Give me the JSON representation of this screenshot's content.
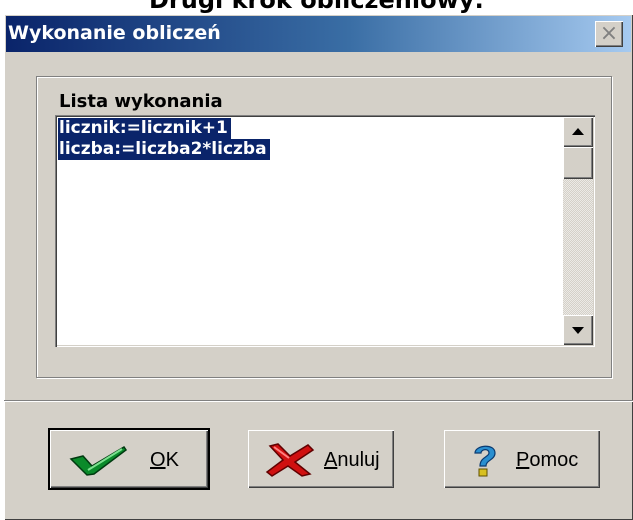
{
  "background": {
    "caption": "Drugi krok obliczeniowy:"
  },
  "window": {
    "title": "Wykonanie obliczeń",
    "close_label": "×"
  },
  "group": {
    "label": "Lista wykonania"
  },
  "list": {
    "items": [
      {
        "text": "licznik:=licznik+1",
        "selected": true
      },
      {
        "text": "liczba:=liczba2*liczba",
        "selected": true
      }
    ]
  },
  "buttons": {
    "ok": {
      "mnemonic": "O",
      "rest": "K",
      "icon": "checkmark-icon"
    },
    "cancel": {
      "mnemonic": "A",
      "rest": "nuluj",
      "icon": "cross-icon"
    },
    "help": {
      "mnemonic": "P",
      "rest": "omoc",
      "icon": "question-mark-icon"
    }
  },
  "colors": {
    "selection": "#0a246a",
    "titlebar_start": "#0a246a",
    "titlebar_end": "#a6caf0",
    "face": "#d4d0c8"
  }
}
